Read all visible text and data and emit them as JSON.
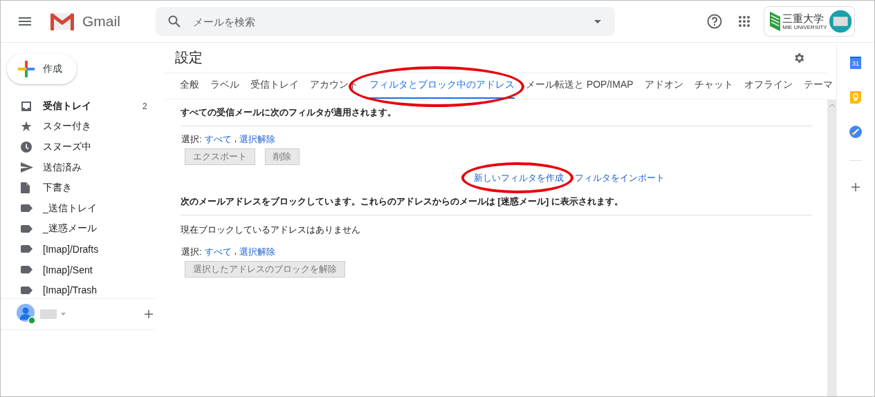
{
  "header": {
    "app_name": "Gmail",
    "search": {
      "placeholder": "メールを検索"
    },
    "org_logo": {
      "name": "三重大学",
      "subtitle": "MIE UNIVERSITY"
    }
  },
  "compose": {
    "label": "作成"
  },
  "sidebar": {
    "items": [
      {
        "label": "受信トレイ",
        "count": "2",
        "kind": "inbox",
        "unread": true
      },
      {
        "label": "スター付き",
        "kind": "star",
        "unread": false
      },
      {
        "label": "スヌーズ中",
        "kind": "clock",
        "unread": false
      },
      {
        "label": "送信済み",
        "kind": "send",
        "unread": false
      },
      {
        "label": "下書き",
        "kind": "draft",
        "unread": false
      },
      {
        "label": "_送信トレイ",
        "kind": "label",
        "unread": false
      },
      {
        "label": "_迷惑メール",
        "kind": "label",
        "unread": false
      },
      {
        "label": "[Imap]/Drafts",
        "kind": "label",
        "unread": false
      },
      {
        "label": "[Imap]/Sent",
        "kind": "label",
        "unread": false
      },
      {
        "label": "[Imap]/Trash",
        "kind": "label",
        "unread": false
      }
    ]
  },
  "settings": {
    "title": "設定",
    "tabs": [
      {
        "label": "全般",
        "selected": false,
        "circled": false
      },
      {
        "label": "ラベル",
        "selected": false,
        "circled": false
      },
      {
        "label": "受信トレイ",
        "selected": false,
        "circled": false
      },
      {
        "label": "アカウント",
        "selected": false,
        "circled": false
      },
      {
        "label": "フィルタとブロック中のアドレス",
        "selected": true,
        "circled": true
      },
      {
        "label": "メール転送と POP/IMAP",
        "selected": false,
        "circled": false
      },
      {
        "label": "アドオン",
        "selected": false,
        "circled": false
      },
      {
        "label": "チャット",
        "selected": false,
        "circled": false
      },
      {
        "label": "オフライン",
        "selected": false,
        "circled": false
      },
      {
        "label": "テーマ",
        "selected": false,
        "circled": false
      }
    ]
  },
  "filters": {
    "heading": "すべての受信メールに次のフィルタが適用されます。",
    "select": {
      "label": "選択:",
      "all": "すべて",
      "separator": ",",
      "none": "選択解除"
    },
    "buttons": [
      {
        "label": "エクスポート",
        "disabled": true
      },
      {
        "label": "削除",
        "disabled": true
      }
    ],
    "links": [
      {
        "label": "新しいフィルタを作成",
        "circled": true
      },
      {
        "label": "フィルタをインポート",
        "circled": false
      }
    ]
  },
  "blocked": {
    "heading": "次のメールアドレスをブロックしています。これらのアドレスからのメールは [迷惑メール] に表示されます。",
    "empty_message": "現在ブロックしているアドレスはありません",
    "select": {
      "label": "選択:",
      "all": "すべて",
      "separator": ",",
      "none": "選択解除"
    },
    "buttons": [
      {
        "label": "選択したアドレスのブロックを解除",
        "disabled": true
      }
    ]
  },
  "side_panel": {
    "calendar_day": "31"
  }
}
